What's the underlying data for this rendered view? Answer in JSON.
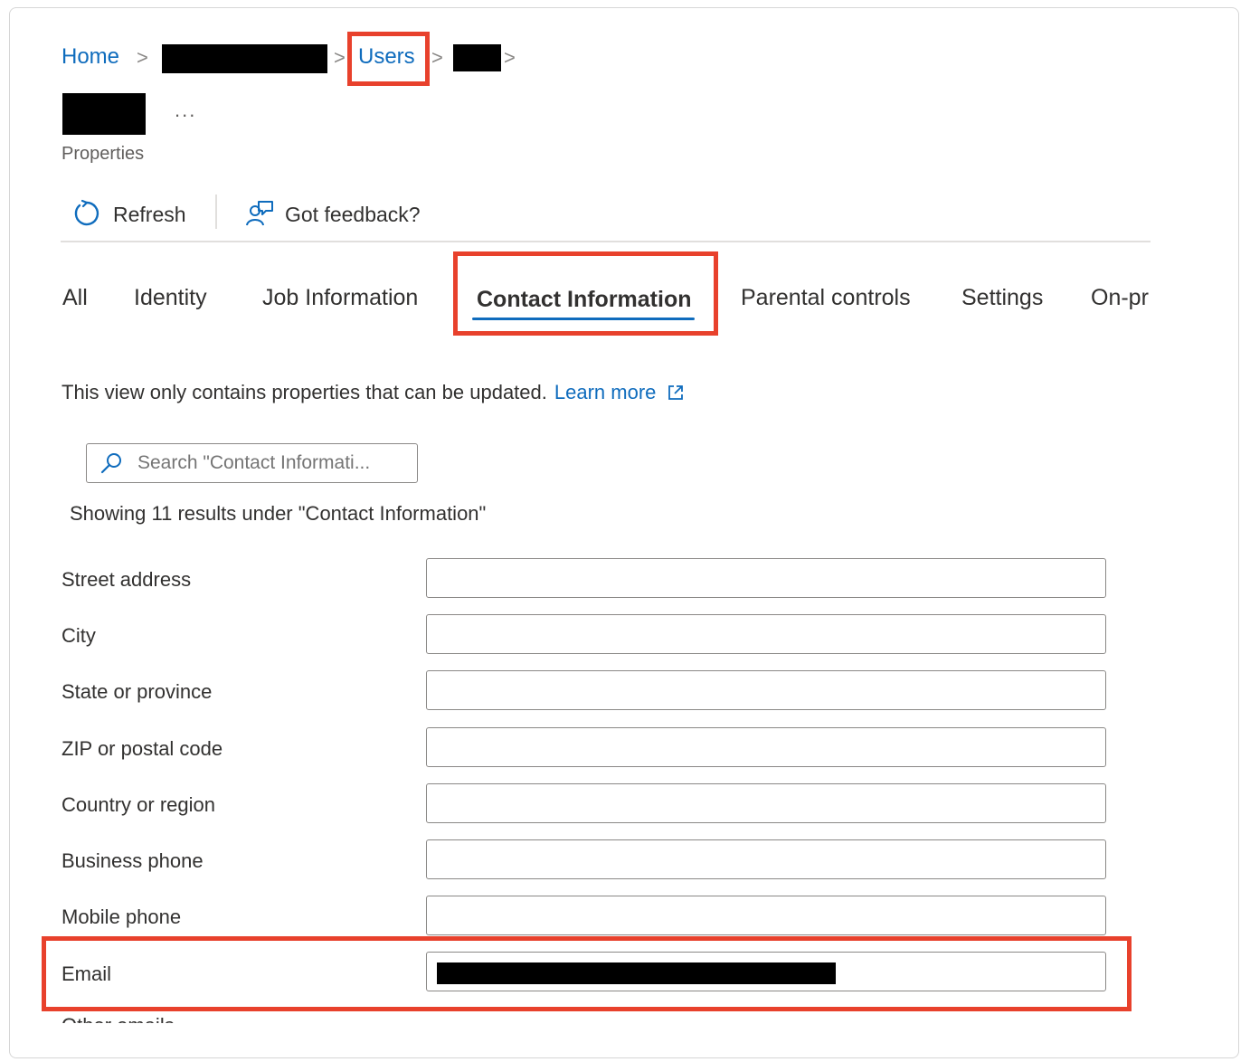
{
  "breadcrumb": {
    "home": "Home",
    "users": "Users",
    "separator": ">"
  },
  "header": {
    "more": "...",
    "subtitle": "Properties"
  },
  "toolbar": {
    "refresh_label": "Refresh",
    "feedback_label": "Got feedback?",
    "refresh_icon": "refresh-icon",
    "feedback_icon": "feedback-icon"
  },
  "tabs": [
    {
      "label": "All"
    },
    {
      "label": "Identity"
    },
    {
      "label": "Job Information"
    },
    {
      "label": "Contact Information",
      "selected": true
    },
    {
      "label": "Parental controls"
    },
    {
      "label": "Settings"
    },
    {
      "label": "On-pr"
    }
  ],
  "info": {
    "text": "This view only contains properties that can be updated.",
    "learn_more": "Learn more",
    "external_icon": "external-link-icon"
  },
  "search": {
    "placeholder": "Search \"Contact Informati...",
    "icon": "search-icon"
  },
  "results_text": "Showing 11 results under \"Contact Information\"",
  "fields": [
    {
      "label": "Street address",
      "value": ""
    },
    {
      "label": "City",
      "value": ""
    },
    {
      "label": "State or province",
      "value": ""
    },
    {
      "label": "ZIP or postal code",
      "value": ""
    },
    {
      "label": "Country or region",
      "value": ""
    },
    {
      "label": "Business phone",
      "value": ""
    },
    {
      "label": "Mobile phone",
      "value": ""
    },
    {
      "label": "Email",
      "value": "",
      "redacted": true
    },
    {
      "label": "Other emails",
      "value": ""
    }
  ],
  "colors": {
    "accent": "#0f6cbd",
    "highlight": "#e8412c",
    "text": "#323130"
  }
}
